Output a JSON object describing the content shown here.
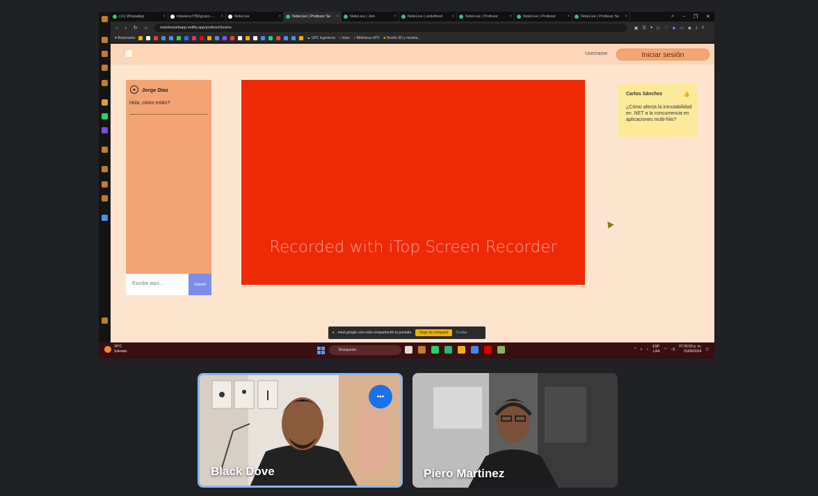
{
  "browser": {
    "tabs": [
      {
        "label": "(11) WhatsApp",
        "color": "#25d366",
        "active": false
      },
      {
        "label": "lrdaviesc/TB2grupo-...",
        "color": "#ffffff",
        "active": false
      },
      {
        "label": "NoteLive",
        "color": "#ffffff",
        "active": false
      },
      {
        "label": "NoteLive | Profesor Se",
        "color": "#42b883",
        "active": true
      },
      {
        "label": "NoteLive | Join",
        "color": "#42b883",
        "active": false
      },
      {
        "label": "NoteLive | undefined",
        "color": "#42b883",
        "active": false
      },
      {
        "label": "NoteLive | Profesor",
        "color": "#42b883",
        "active": false
      },
      {
        "label": "NoteLive | Profesor",
        "color": "#42b883",
        "active": false
      },
      {
        "label": "NoteLive | Profesor Se",
        "color": "#42b883",
        "active": false
      }
    ],
    "url": "notelivewebapp.netlify.app/profesorSesion",
    "bookmarks": [
      "Bookmarks",
      "UPC Ingeniería",
      "Inicio",
      "Biblioteca UPC",
      "Diseño 3D y modela..."
    ]
  },
  "app": {
    "username_label": "Username",
    "login_label": "Iniciar sesión",
    "chat": {
      "user": "Jorge Díaz",
      "message": "Hola, cómo están?",
      "input_placeholder": "Escribe aquí...",
      "submit_label": "Submit"
    },
    "video": {
      "watermark": "Recorded with iTop Screen Recorder",
      "color": "#ee2a06"
    },
    "question": {
      "author": "Carlos Sánchez",
      "text": "¿Cómo afecta la inmutabilidad en .NET a la concurrencia en aplicaciones multi-hilo?"
    }
  },
  "share_bar": {
    "text": "meet.google.com está compartiendo tu pantalla.",
    "stop_label": "Dejar de compartir",
    "hide_label": "Ocultar"
  },
  "taskbar": {
    "weather_temp": "20°C",
    "weather_desc": "Soleado",
    "search_label": "Búsqueda",
    "lang": "ESP\nLAA",
    "time": "07:26:59 p. m.",
    "date": "01/06/2024"
  },
  "participants": [
    {
      "name": "Black Dove",
      "speaking": true
    },
    {
      "name": "Piero Martinez",
      "speaking": false
    }
  ]
}
